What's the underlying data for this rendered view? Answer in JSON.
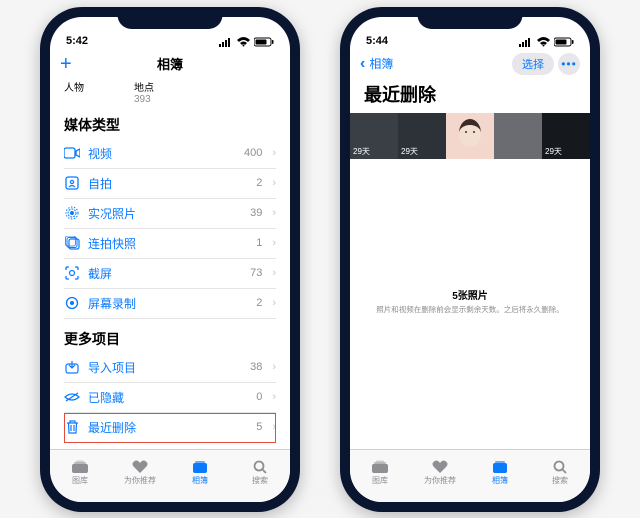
{
  "status": {
    "time_left": "5:42",
    "time_right": "5:44",
    "signal": "●●●●",
    "wifi": "wifi",
    "battery": "batt"
  },
  "left": {
    "nav": {
      "title": "相簿",
      "plus": "+"
    },
    "sub": {
      "people_label": "人物",
      "places_label": "地点",
      "places_count": "393"
    },
    "section_media": "媒体类型",
    "media_rows": [
      {
        "icon": "video",
        "label": "视频",
        "count": "400"
      },
      {
        "icon": "selfie",
        "label": "自拍",
        "count": "2"
      },
      {
        "icon": "live",
        "label": "实况照片",
        "count": "39"
      },
      {
        "icon": "burst",
        "label": "连拍快照",
        "count": "1"
      },
      {
        "icon": "screenshot",
        "label": "截屏",
        "count": "73"
      },
      {
        "icon": "record",
        "label": "屏幕录制",
        "count": "2"
      }
    ],
    "section_more": "更多项目",
    "more_rows": [
      {
        "icon": "import",
        "label": "导入项目",
        "count": "38"
      },
      {
        "icon": "hidden",
        "label": "已隐藏",
        "count": "0"
      },
      {
        "icon": "trash",
        "label": "最近删除",
        "count": "5"
      }
    ]
  },
  "right": {
    "nav": {
      "back": "相簿",
      "select": "选择"
    },
    "title": "最近删除",
    "thumbs": [
      {
        "days": "29天"
      },
      {
        "days": "29天"
      },
      {
        "days": ""
      },
      {
        "days": ""
      },
      {
        "days": "29天"
      }
    ],
    "footer": {
      "title": "5张照片",
      "sub": "照片和视频在删除前会显示剩余天数。之后将永久删除。"
    }
  },
  "tabs": [
    {
      "icon": "library",
      "label": "图库"
    },
    {
      "icon": "foryou",
      "label": "为你推荐"
    },
    {
      "icon": "albums",
      "label": "相簿"
    },
    {
      "icon": "search",
      "label": "搜索"
    }
  ]
}
